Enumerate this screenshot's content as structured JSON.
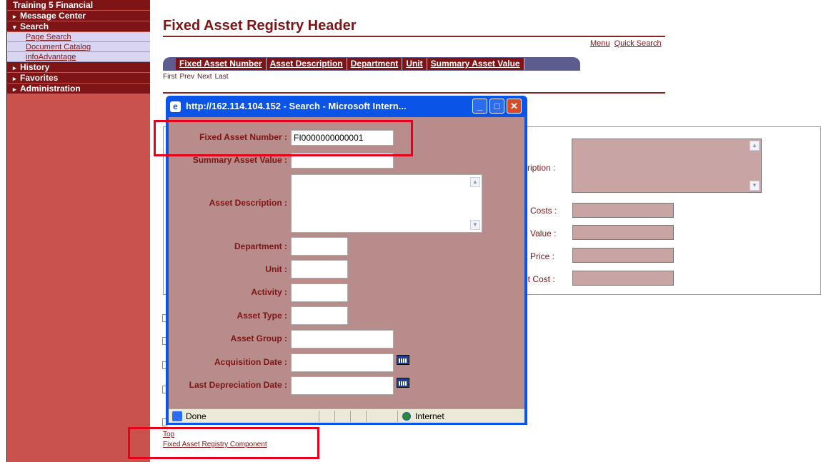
{
  "sidebar": {
    "title": "Training 5 Financial",
    "items": [
      {
        "label": "Message Center",
        "arrow": "▸"
      },
      {
        "label": "Search",
        "arrow": "▾",
        "sub": [
          "Page Search",
          "Document Catalog",
          "infoAdvantage"
        ]
      },
      {
        "label": "History",
        "arrow": "▸"
      },
      {
        "label": "Favorites",
        "arrow": "▸"
      },
      {
        "label": "Administration",
        "arrow": "▸"
      }
    ]
  },
  "page": {
    "title": "Fixed Asset Registry Header",
    "menu_link": "Menu",
    "quick_search_link": "Quick Search",
    "tabs": [
      "Fixed Asset Number",
      "Asset Description",
      "Department",
      "Unit",
      "Summary Asset Value"
    ],
    "pager": [
      "First",
      "Prev",
      "Next",
      "Last"
    ],
    "right_labels": [
      "cription :",
      "g Costs :",
      "e Value :",
      "g Price :",
      "et Cost :"
    ],
    "bottom_links": {
      "top": "Top",
      "component": "Fixed Asset Registry Component"
    }
  },
  "popup": {
    "title": "http://162.114.104.152 - Search - Microsoft Intern...",
    "fields": {
      "fixed_asset_number": {
        "label": "Fixed Asset Number :",
        "value": "FI0000000000001"
      },
      "summary_asset_value": {
        "label": "Summary Asset Value :",
        "value": ""
      },
      "asset_description": {
        "label": "Asset Description :",
        "value": ""
      },
      "department": {
        "label": "Department :",
        "value": ""
      },
      "unit": {
        "label": "Unit :",
        "value": ""
      },
      "activity": {
        "label": "Activity :",
        "value": ""
      },
      "asset_type": {
        "label": "Asset Type :",
        "value": ""
      },
      "asset_group": {
        "label": "Asset Group :",
        "value": ""
      },
      "acquisition_date": {
        "label": "Acquisition Date :",
        "value": ""
      },
      "last_depreciation_date": {
        "label": "Last Depreciation Date :",
        "value": ""
      }
    },
    "status": {
      "text": "Done",
      "zone": "Internet"
    }
  }
}
